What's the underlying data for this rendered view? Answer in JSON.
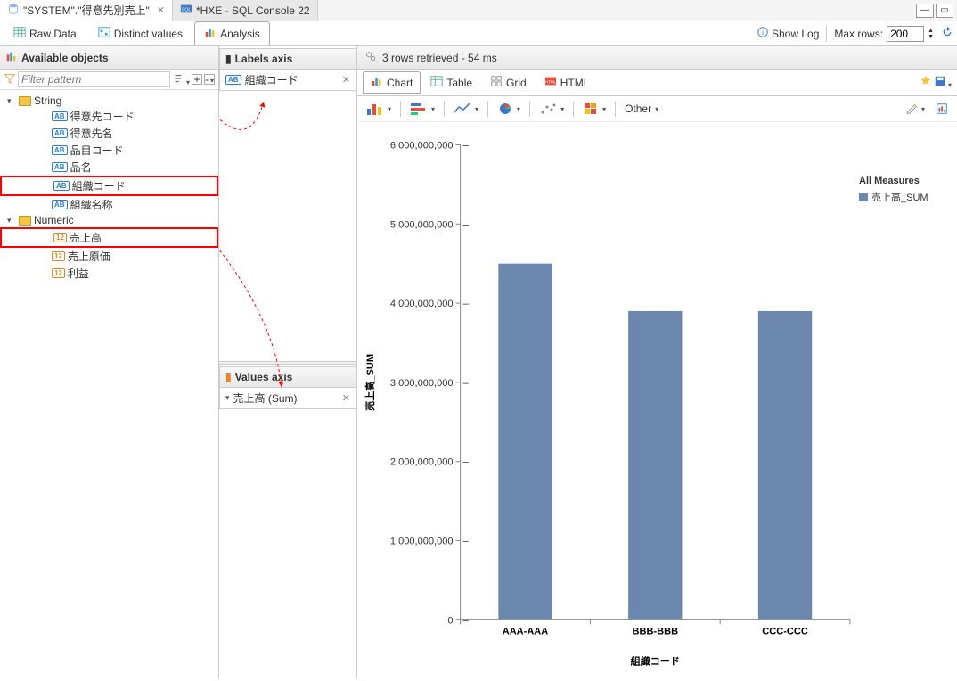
{
  "tabs": {
    "active": "\"SYSTEM\".\"得意先別売上\"",
    "other": "*HXE - SQL Console 22"
  },
  "toolbar": {
    "raw": "Raw Data",
    "distinct": "Distinct values",
    "analysis": "Analysis",
    "showLog": "Show Log",
    "maxRowsLabel": "Max rows:",
    "maxRowsVal": "200"
  },
  "sidebar": {
    "title": "Available objects",
    "filterPlaceholder": "Filter pattern",
    "stringFolder": "String",
    "stringItems": [
      "得意先コード",
      "得意先名",
      "品目コード",
      "品名",
      "組織コード",
      "組織名称"
    ],
    "numericFolder": "Numeric",
    "numericItems": [
      "売上高",
      "売上原価",
      "利益"
    ]
  },
  "labelsAxis": {
    "title": "Labels axis",
    "item": "組織コード"
  },
  "valuesAxis": {
    "title": "Values axis",
    "item": "売上高 (Sum)"
  },
  "retrieved": "3 rows retrieved - 54 ms",
  "viewTabs": {
    "chart": "Chart",
    "table": "Table",
    "grid": "Grid",
    "html": "HTML"
  },
  "chartToolbar": {
    "other": "Other"
  },
  "legend": {
    "title": "All Measures",
    "item": "売上高_SUM"
  },
  "chart_data": {
    "type": "bar",
    "categories": [
      "AAA-AAA",
      "BBB-BBB",
      "CCC-CCC"
    ],
    "values": [
      4500000000,
      3900000000,
      3900000000
    ],
    "xlabel": "組織コード",
    "ylabel": "売上高_SUM",
    "ylim": [
      0,
      6000000000
    ],
    "yticks": [
      0,
      1000000000,
      2000000000,
      3000000000,
      4000000000,
      5000000000,
      6000000000
    ],
    "ytickLabels": [
      "0",
      "1,000,000,000",
      "2,000,000,000",
      "3,000,000,000",
      "4,000,000,000",
      "5,000,000,000",
      "6,000,000,000"
    ]
  }
}
